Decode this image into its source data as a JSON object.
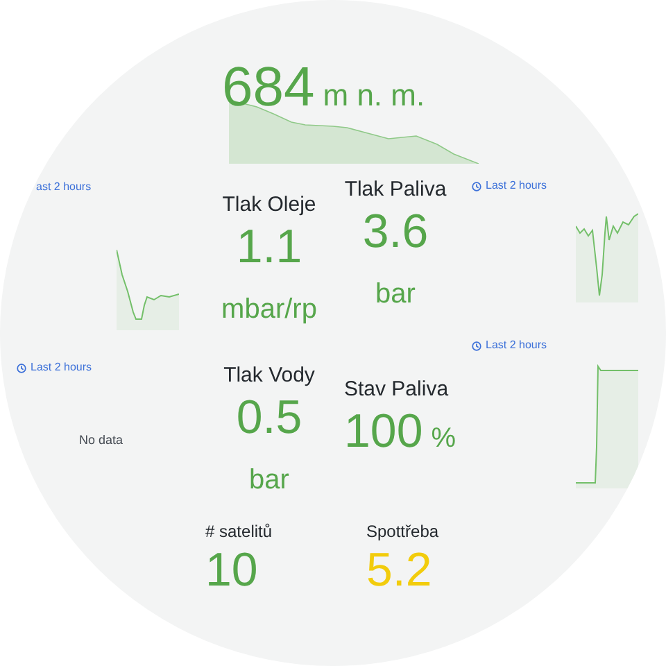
{
  "altitude": {
    "value": "684",
    "unit": "m n. m."
  },
  "trends": [
    {
      "time_range": "ast 2 hours",
      "clock_icon": false,
      "kind": "sparkline"
    },
    {
      "time_range": "Last 2 hours",
      "clock_icon": true,
      "kind": "sparkline"
    },
    {
      "time_range": "Last 2 hours",
      "clock_icon": true,
      "kind": "sparkline"
    },
    {
      "time_range": "Last 2 hours",
      "clock_icon": true,
      "kind": "no_data",
      "message": "No data"
    }
  ],
  "stats": [
    {
      "title": "Tlak Oleje",
      "value": "1.1",
      "unit": "mbar/rp",
      "kind": "unit_below",
      "color": "#56a64b"
    },
    {
      "title": "Tlak Paliva",
      "value": "3.6",
      "unit": "bar",
      "kind": "unit_below",
      "color": "#56a64b"
    },
    {
      "title": "Tlak Vody",
      "value": "0.5",
      "unit": "bar",
      "kind": "unit_below",
      "color": "#56a64b"
    },
    {
      "title": "Stav Paliva",
      "value": "100",
      "unit": "%",
      "kind": "unit_inline",
      "color": "#56a64b"
    },
    {
      "title": "# satelitů",
      "value": "10",
      "color": "#56a64b"
    },
    {
      "title": "Spottřeba",
      "value": "5.2",
      "color": "#f2cc0c"
    }
  ]
}
